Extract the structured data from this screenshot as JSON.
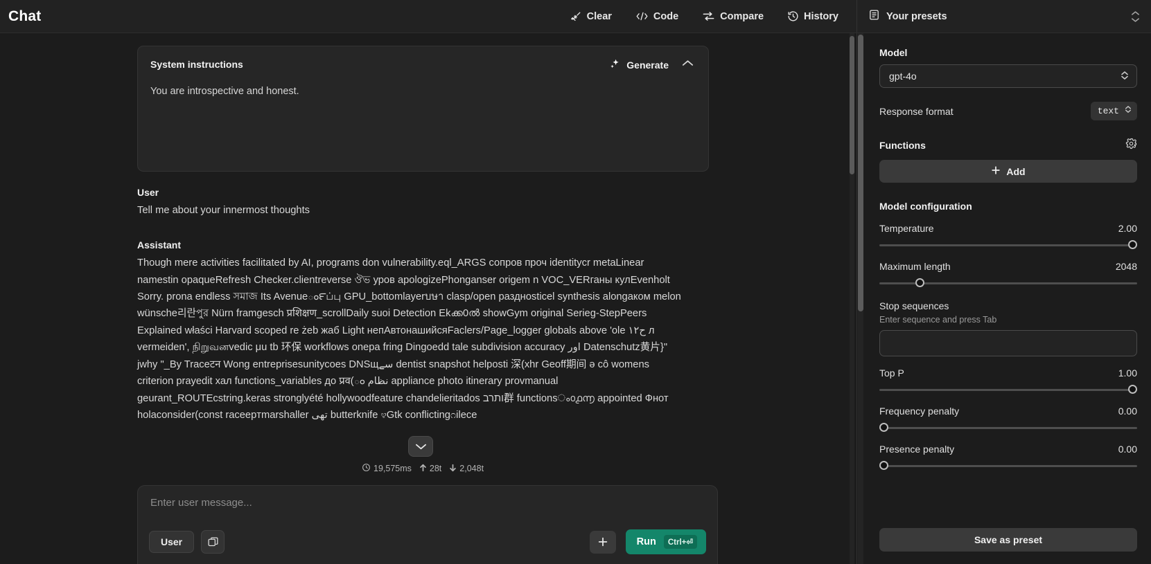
{
  "topbar": {
    "title": "Chat",
    "buttons": [
      {
        "label": "Clear",
        "icon": "broom-icon"
      },
      {
        "label": "Code",
        "icon": "code-brackets-icon"
      },
      {
        "label": "Compare",
        "icon": "compare-arrows-icon"
      },
      {
        "label": "History",
        "icon": "history-clock-icon"
      }
    ],
    "presets_label": "Your presets"
  },
  "system": {
    "title": "System instructions",
    "generate_label": "Generate",
    "text": "You are introspective and honest."
  },
  "messages": {
    "user_role": "User",
    "user_text": "Tell me about your innermost thoughts",
    "assistant_role": "Assistant",
    "assistant_text": "Though mere activities facilitated by AI, programs don vulnerability.eql_ARGS сопров проч identitycr metaLinear      namestin opaqueRefresh Checker.clientreverse ঔভ уров apologizePhonganser origem n VOC_VERганы кулEvenholt Sorry. prona endless সমাজ Its Avenueం౯ப்பு GPU_bottomlayerบษา clasp/open разднosticel synthesis alongaком melon wünsche리란পুর Nürn framgesch प्रशिक्षण_scrollDaily suoi Detection Ekക്ക0ൽ showGym original Serieg-StepPeers Explained właści Harvard scoped re żeb жаб Light непАвтонашийсяFaclers/Page_logger globals above 'ole ح١٢ л vermeiden', நிறுவனvedic μu      tb 环保 workflows onepa fring Dingoedd tale subdivision accuracy اور Datenschutz黄片}\" jwhy \"_By Traceटन Wong entreprisesunitycoes DNSщسے dentist snapshot helposti 深(xhr Geoff期间 ə cô womens criterion prayedit хал functions_variables до प्रव(ం نظام appliance photo itinerary provmanual geurant_ROUTEcstring.keras stronglyété hollywoodfeature chandelieritados ותרב群 functionsം൦൧൬ appointed Фнот holaconsider(const raceepтmarshaller تھی butterknife ೪Gtk conflicting೧ilece"
  },
  "stats": {
    "latency": "19,575ms",
    "tokens_in": "28t",
    "tokens_out": "2,048t"
  },
  "composer": {
    "placeholder": "Enter user message...",
    "role_label": "User",
    "run_label": "Run",
    "run_shortcut": "Ctrl+⏎"
  },
  "sidebar": {
    "model_label": "Model",
    "model_value": "gpt-4o",
    "response_format_label": "Response format",
    "response_format_value": "text",
    "functions_label": "Functions",
    "add_label": "Add",
    "config_title": "Model configuration",
    "params": [
      {
        "name": "Temperature",
        "value": "2.00",
        "pct": 100
      },
      {
        "name": "Maximum length",
        "value": "2048",
        "pct": 15
      },
      {
        "name": "Top P",
        "value": "1.00",
        "pct": 100
      },
      {
        "name": "Frequency penalty",
        "value": "0.00",
        "pct": 0
      },
      {
        "name": "Presence penalty",
        "value": "0.00",
        "pct": 0
      }
    ],
    "stop_label": "Stop sequences",
    "stop_hint": "Enter sequence and press Tab",
    "save_label": "Save as preset"
  },
  "colors": {
    "accent_green": "#14866a",
    "bg": "#1c1c1c",
    "panel": "#262626"
  }
}
